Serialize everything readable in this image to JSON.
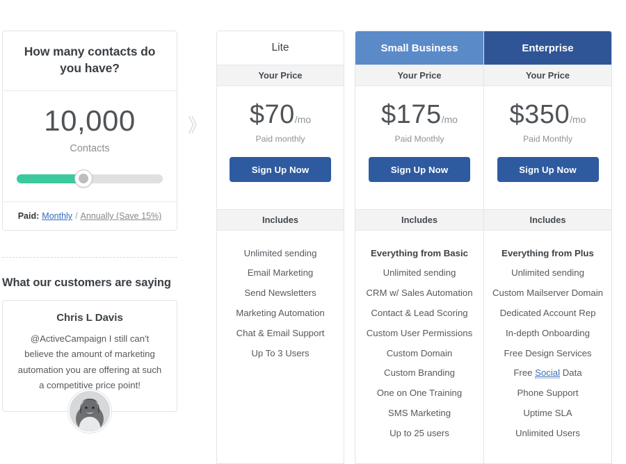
{
  "calculator": {
    "question": "How many contacts do you have?",
    "contacts_value": "10,000",
    "contacts_label": "Contacts",
    "slider_percent": 43,
    "slider_fill_color": "#3cc9a0",
    "slider_track_color": "#e0e0e0",
    "paid_label": "Paid:",
    "paid_option_monthly": "Monthly",
    "paid_separator": "/",
    "paid_option_annually": "Annually (Save 15%)"
  },
  "arrow": {
    "glyph": "》"
  },
  "testimonials": {
    "heading": "What our customers are saying",
    "author": "Chris L Davis",
    "quote": "@ActiveCampaign I still can't believe the amount of marketing automation you are offering at such a competitive price point!"
  },
  "plans": [
    {
      "name": "Lite",
      "header_style": "light",
      "price_band": "Your Price",
      "price": "$70",
      "price_suffix": "/mo",
      "price_note": "Paid monthly",
      "cta_label": "Sign Up Now",
      "includes_band": "Includes",
      "features": [
        {
          "text": "Unlimited sending",
          "bold": false
        },
        {
          "text": "Email Marketing",
          "bold": false
        },
        {
          "text": "Send Newsletters",
          "bold": false
        },
        {
          "text": "Marketing Automation",
          "bold": false
        },
        {
          "text": "Chat & Email Support",
          "bold": false
        },
        {
          "text": "Up To 3 Users",
          "bold": false
        }
      ]
    },
    {
      "name": "Small Business",
      "header_style": "mid",
      "header_color": "#5b8ac9",
      "price_band": "Your Price",
      "price": "$175",
      "price_suffix": "/mo",
      "price_note": "Paid Monthly",
      "cta_label": "Sign Up Now",
      "includes_band": "Includes",
      "features": [
        {
          "text": "Everything from Basic",
          "bold": true
        },
        {
          "text": "Unlimited sending",
          "bold": false
        },
        {
          "text": "CRM w/ Sales Automation",
          "bold": false
        },
        {
          "text": "Contact & Lead Scoring",
          "bold": false
        },
        {
          "text": "Custom User Permissions",
          "bold": false
        },
        {
          "text": "Custom Domain",
          "bold": false
        },
        {
          "text": "Custom Branding",
          "bold": false
        },
        {
          "text": "One on One Training",
          "bold": false
        },
        {
          "text": "SMS Marketing",
          "bold": false
        },
        {
          "text": "Up to 25 users",
          "bold": false
        }
      ]
    },
    {
      "name": "Enterprise",
      "header_style": "dark",
      "header_color": "#2f5596",
      "price_band": "Your Price",
      "price": "$350",
      "price_suffix": "/mo",
      "price_note": "Paid Monthly",
      "cta_label": "Sign Up Now",
      "includes_band": "Includes",
      "features": [
        {
          "text": "Everything from Plus",
          "bold": true
        },
        {
          "text": "Unlimited sending",
          "bold": false
        },
        {
          "text": "Custom Mailserver Domain",
          "bold": false
        },
        {
          "text": "Dedicated Account Rep",
          "bold": false
        },
        {
          "text": "In-depth Onboarding",
          "bold": false
        },
        {
          "text": "Free Design Services",
          "bold": false
        },
        {
          "text": "Free Social Data",
          "bold": false,
          "link_word": "Social"
        },
        {
          "text": "Phone Support",
          "bold": false
        },
        {
          "text": "Uptime SLA",
          "bold": false
        },
        {
          "text": "Unlimited Users",
          "bold": false
        }
      ]
    }
  ],
  "colors": {
    "cta_blue": "#2e5aa0",
    "link_blue": "#2f6bbd",
    "accent_green": "#3cc9a0",
    "band_gray": "#f3f3f4"
  }
}
